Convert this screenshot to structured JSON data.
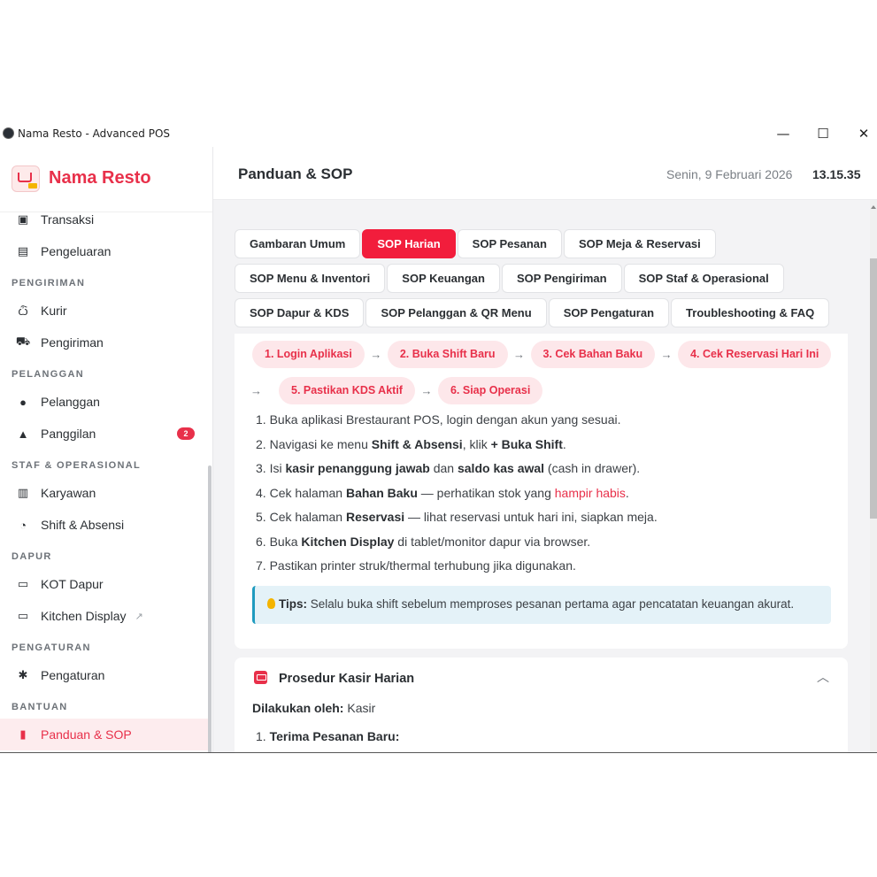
{
  "window": {
    "title": "Nama Resto - Advanced POS",
    "controls": {
      "minimize": "—",
      "maximize": "☐",
      "close": "✕"
    }
  },
  "sidebar": {
    "brand": "Nama Resto",
    "items": [
      {
        "label": "Transaksi",
        "icon": "cash-icon"
      },
      {
        "label": "Pengeluaran",
        "icon": "receipt-icon"
      },
      {
        "section": "PENGIRIMAN"
      },
      {
        "label": "Kurir",
        "icon": "motorcycle-icon"
      },
      {
        "label": "Pengiriman",
        "icon": "truck-icon"
      },
      {
        "section": "PELANGGAN"
      },
      {
        "label": "Pelanggan",
        "icon": "users-icon"
      },
      {
        "label": "Panggilan",
        "icon": "bell-icon",
        "badge": "2"
      },
      {
        "section": "STAF & OPERASIONAL"
      },
      {
        "label": "Karyawan",
        "icon": "id-badge-icon"
      },
      {
        "label": "Shift & Absensi",
        "icon": "user-clock-icon"
      },
      {
        "section": "DAPUR"
      },
      {
        "label": "KOT Dapur",
        "icon": "ticket-icon"
      },
      {
        "label": "Kitchen Display",
        "icon": "monitor-icon",
        "external": true
      },
      {
        "section": "PENGATURAN"
      },
      {
        "label": "Pengaturan",
        "icon": "gear-icon"
      },
      {
        "section": "BANTUAN"
      },
      {
        "label": "Panduan & SOP",
        "icon": "book-icon",
        "active": true
      }
    ]
  },
  "header": {
    "title": "Panduan & SOP",
    "date": "Senin, 9 Februari 2026",
    "time": "13.15.35"
  },
  "tabs": [
    [
      "Gambaran Umum",
      "SOP Harian",
      "SOP Pesanan",
      "SOP Meja & Reservasi"
    ],
    [
      "SOP Menu & Inventori",
      "SOP Keuangan",
      "SOP Pengiriman",
      "SOP Staf & Operasional"
    ],
    [
      "SOP Dapur & KDS",
      "SOP Pelanggan & QR Menu",
      "SOP Pengaturan",
      "Troubleshooting & FAQ"
    ]
  ],
  "active_tab": "SOP Harian",
  "steps": [
    "1. Login Aplikasi",
    "2. Buka Shift Baru",
    "3. Cek Bahan Baku",
    "4. Cek Reservasi Hari Ini",
    "5. Pastikan KDS Aktif",
    "6. Siap Operasi"
  ],
  "instructions": [
    [
      {
        "t": "Buka aplikasi Brestaurant POS, login dengan akun yang sesuai."
      }
    ],
    [
      {
        "t": "Navigasi ke menu "
      },
      {
        "t": "Shift & Absensi",
        "b": true
      },
      {
        "t": ", klik "
      },
      {
        "t": "+ Buka Shift",
        "b": true
      },
      {
        "t": "."
      }
    ],
    [
      {
        "t": "Isi "
      },
      {
        "t": "kasir penanggung jawab",
        "b": true
      },
      {
        "t": " dan "
      },
      {
        "t": "saldo kas awal",
        "b": true
      },
      {
        "t": " (cash in drawer)."
      }
    ],
    [
      {
        "t": "Cek halaman "
      },
      {
        "t": "Bahan Baku",
        "b": true
      },
      {
        "t": " — perhatikan stok yang "
      },
      {
        "t": "hampir habis",
        "red": true
      },
      {
        "t": "."
      }
    ],
    [
      {
        "t": "Cek halaman "
      },
      {
        "t": "Reservasi",
        "b": true
      },
      {
        "t": " — lihat reservasi untuk hari ini, siapkan meja."
      }
    ],
    [
      {
        "t": "Buka "
      },
      {
        "t": "Kitchen Display",
        "b": true
      },
      {
        "t": " di tablet/monitor dapur via browser."
      }
    ],
    [
      {
        "t": "Pastikan printer struk/thermal terhubung jika digunakan."
      }
    ]
  ],
  "tips": {
    "label": "Tips:",
    "text": " Selalu buka shift sebelum memproses pesanan pertama agar pencatatan keuangan akurat."
  },
  "procedure": {
    "title": "Prosedur Kasir Harian",
    "by_label": "Dilakukan oleh:",
    "by_value": " Kasir",
    "first_step": "Terima Pesanan Baru:"
  },
  "colors": {
    "accent": "#e8304a",
    "active_tab": "#f21d3c",
    "tips_border": "#1f9bbf"
  }
}
